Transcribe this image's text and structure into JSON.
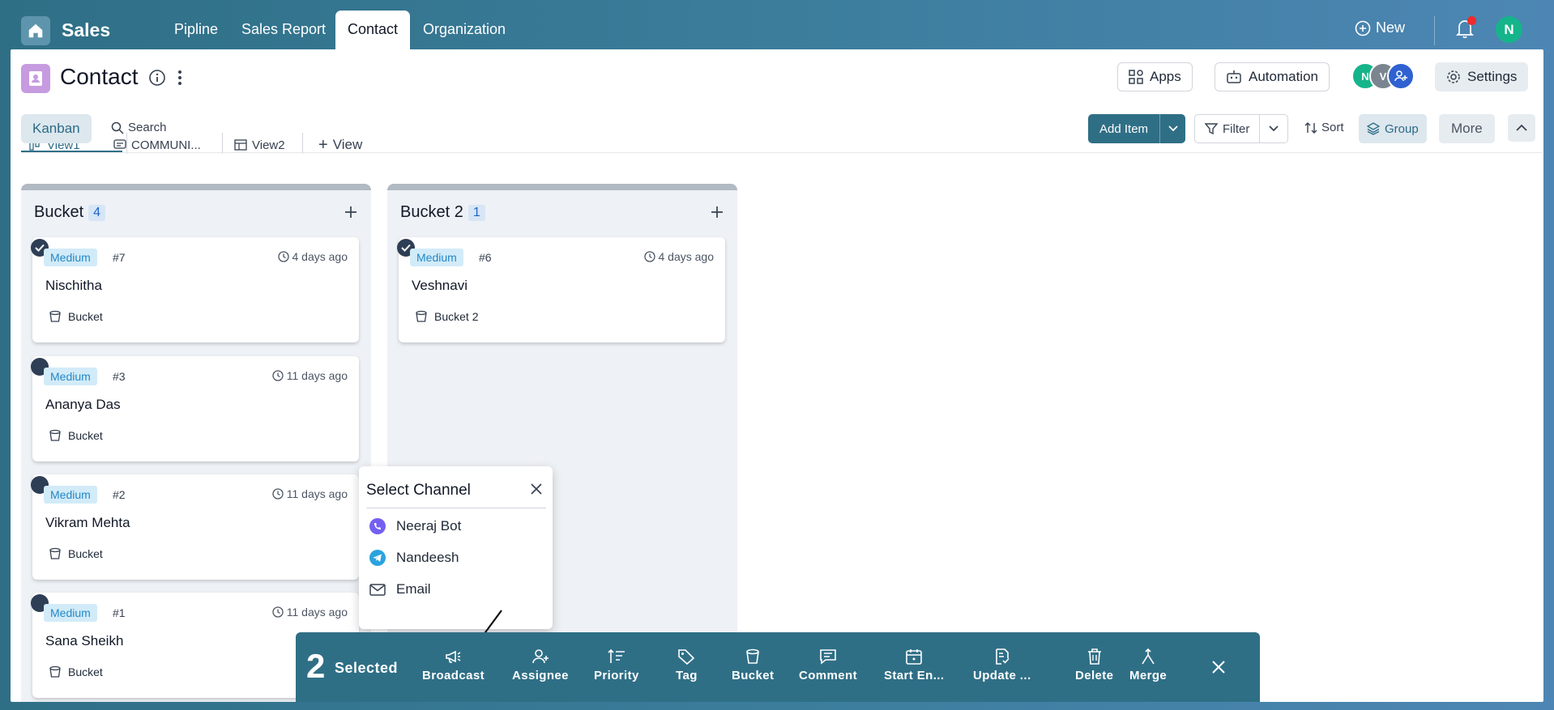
{
  "app": {
    "title": "Sales",
    "nav_tabs": [
      "Pipline",
      "Sales Report",
      "Contact",
      "Organization"
    ],
    "active_tab": "Contact",
    "new_label": "New",
    "user_initial": "N"
  },
  "page": {
    "title": "Contact",
    "buttons": {
      "apps": "Apps",
      "automation": "Automation",
      "settings": "Settings"
    },
    "member_avatars": [
      "N",
      "V"
    ]
  },
  "views": {
    "tabs": [
      "View1",
      "COMMUNI...",
      "View2"
    ],
    "add_view": "View",
    "active": "View1"
  },
  "toolbar": {
    "kanban": "Kanban",
    "search": "Search",
    "add_item": "Add Item",
    "filter": "Filter",
    "sort": "Sort",
    "group": "Group",
    "more": "More"
  },
  "columns": [
    {
      "title": "Bucket",
      "count": "4",
      "cards": [
        {
          "priority": "Medium",
          "id": "#7",
          "time": "4 days ago",
          "name": "Nischitha",
          "bucket": "Bucket",
          "selected": true
        },
        {
          "priority": "Medium",
          "id": "#3",
          "time": "11 days ago",
          "name": "Ananya Das",
          "bucket": "Bucket",
          "selected": false
        },
        {
          "priority": "Medium",
          "id": "#2",
          "time": "11 days ago",
          "name": "Vikram Mehta",
          "bucket": "Bucket",
          "selected": false
        },
        {
          "priority": "Medium",
          "id": "#1",
          "time": "11 days ago",
          "name": "Sana Sheikh",
          "bucket": "Bucket",
          "selected": false
        }
      ]
    },
    {
      "title": "Bucket 2",
      "count": "1",
      "cards": [
        {
          "priority": "Medium",
          "id": "#6",
          "time": "4 days ago",
          "name": "Veshnavi",
          "bucket": "Bucket 2",
          "selected": true
        }
      ]
    }
  ],
  "select_channel": {
    "title": "Select Channel",
    "channels": [
      {
        "name": "Neeraj Bot",
        "icon": "viber-icon"
      },
      {
        "name": "Nandeesh",
        "icon": "telegram-icon"
      },
      {
        "name": "Email",
        "icon": "email-icon"
      }
    ]
  },
  "bulk_bar": {
    "count": "2",
    "label": "Selected",
    "actions": [
      "Broadcast",
      "Assignee",
      "Priority",
      "Tag",
      "Bucket",
      "Comment",
      "Start En...",
      "Update ...",
      "Delete",
      "Merge"
    ]
  },
  "colors": {
    "accent": "#2f6f86",
    "badge_bg": "#d2ebf8",
    "badge_text": "#2388c8",
    "notification_dot": "#ef2b2b"
  }
}
